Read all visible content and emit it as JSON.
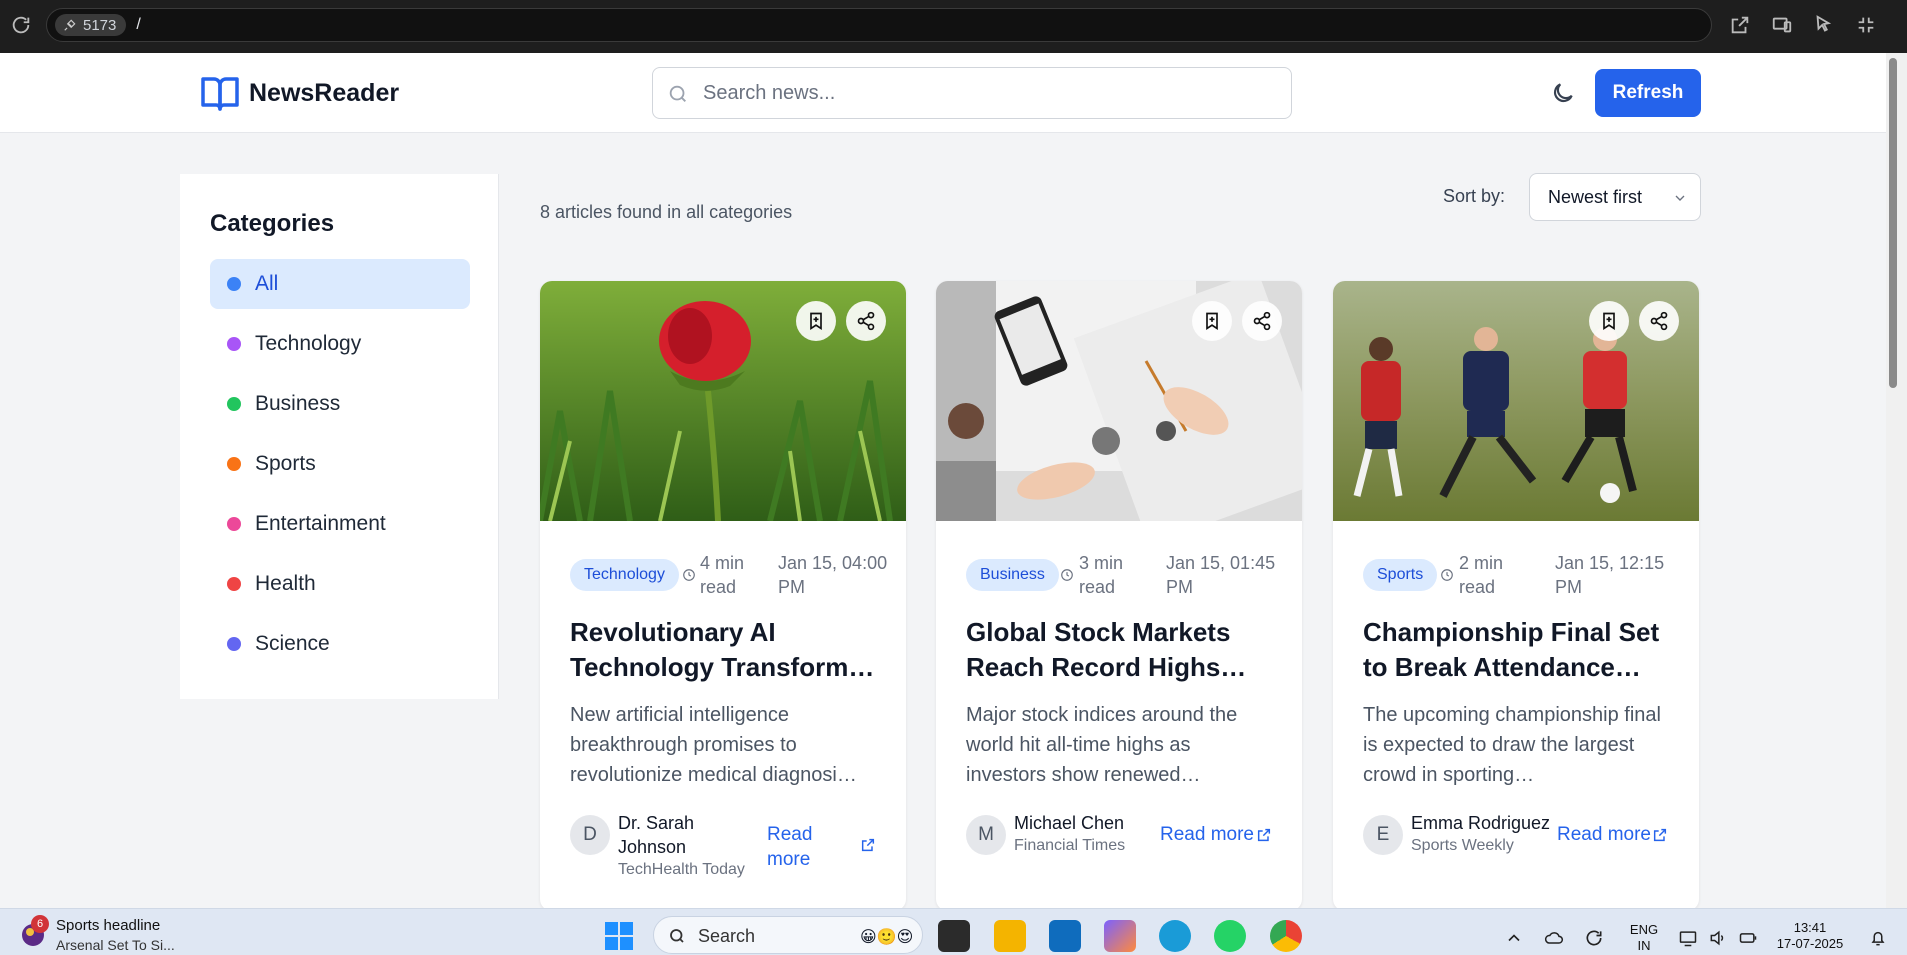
{
  "browser": {
    "port": "5173",
    "path": "/"
  },
  "header": {
    "app_name": "NewsReader",
    "search_placeholder": "Search news...",
    "refresh_label": "Refresh"
  },
  "sidebar": {
    "title": "Categories",
    "items": [
      {
        "label": "All",
        "color": "#3b82f6",
        "active": true
      },
      {
        "label": "Technology",
        "color": "#a855f7"
      },
      {
        "label": "Business",
        "color": "#22c55e"
      },
      {
        "label": "Sports",
        "color": "#f97316"
      },
      {
        "label": "Entertainment",
        "color": "#ec4899"
      },
      {
        "label": "Health",
        "color": "#ef4444"
      },
      {
        "label": "Science",
        "color": "#6366f1"
      }
    ]
  },
  "main": {
    "count_text": "8 articles found in all categories",
    "sort_label": "Sort by:",
    "sort_value": "Newest first"
  },
  "articles": [
    {
      "category": "Technology",
      "read_time": "4 min read",
      "date": "Jan 15, 04:00 PM",
      "title": "Revolutionary AI Technology Transform…",
      "excerpt": "New artificial intelligence breakthrough promises to revolutionize medical diagnosi…",
      "author_initial": "D",
      "author": "Dr. Sarah Johnson",
      "source": "TechHealth Today",
      "read_more": "Read more"
    },
    {
      "category": "Business",
      "read_time": "3 min read",
      "date": "Jan 15, 01:45 PM",
      "title": "Global Stock Markets Reach Record Highs…",
      "excerpt": "Major stock indices around the world hit all-time highs as investors show renewed…",
      "author_initial": "M",
      "author": "Michael Chen",
      "source": "Financial Times",
      "read_more": "Read more"
    },
    {
      "category": "Sports",
      "read_time": "2 min read",
      "date": "Jan 15, 12:15 PM",
      "title": "Championship Final Set to Break Attendance…",
      "excerpt": "The upcoming championship final is expected to draw the largest crowd in sporting…",
      "author_initial": "E",
      "author": "Emma Rodriguez",
      "source": "Sports Weekly",
      "read_more": "Read more"
    }
  ],
  "taskbar": {
    "news_badge": "6",
    "news_title": "Sports headline",
    "news_sub": "Arsenal Set To Si...",
    "search_label": "Search",
    "lang_line1": "ENG",
    "lang_line2": "IN",
    "time": "13:41",
    "date": "17-07-2025"
  }
}
